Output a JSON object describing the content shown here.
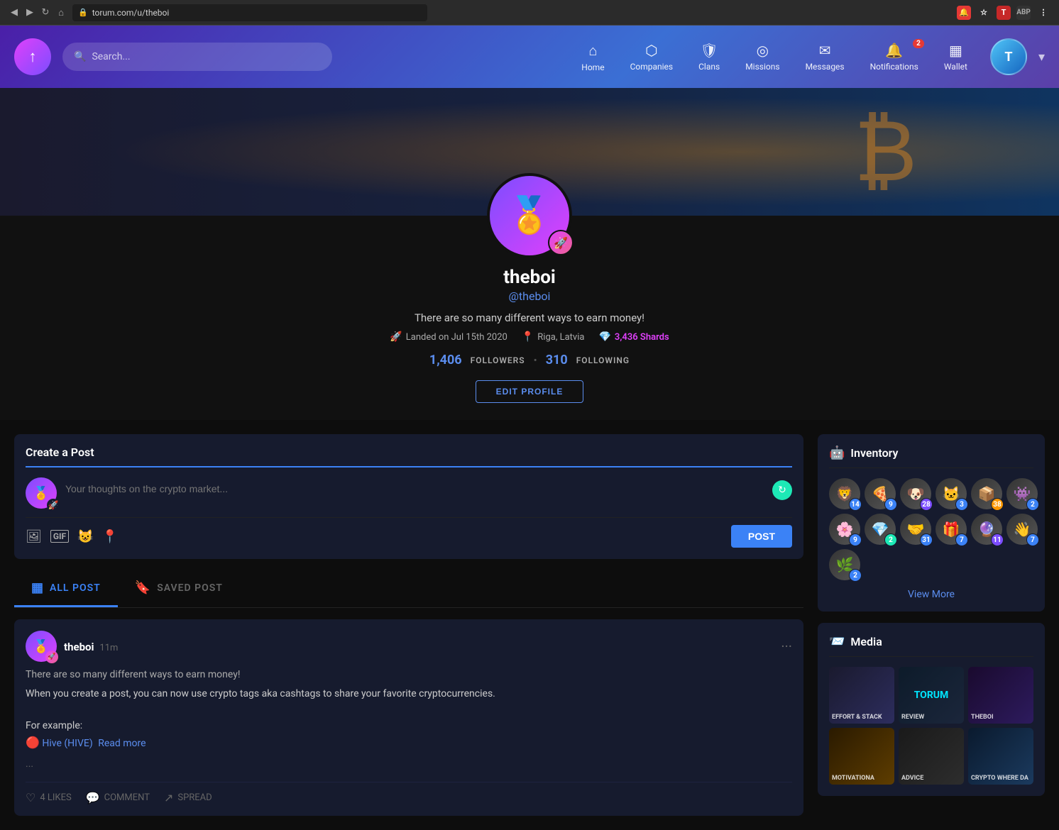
{
  "browser": {
    "url": "torum.com/u/theboi",
    "back_icon": "◀",
    "forward_icon": "▶",
    "reload_icon": "↻",
    "lock_icon": "🔒"
  },
  "nav": {
    "logo_icon": "↑",
    "search_placeholder": "Search...",
    "search_icon": "🔍",
    "items": [
      {
        "label": "Home",
        "icon": "⌂",
        "badge": null
      },
      {
        "label": "Companies",
        "icon": "⬡",
        "badge": null
      },
      {
        "label": "Clans",
        "icon": "🛡",
        "badge": null
      },
      {
        "label": "Missions",
        "icon": "◎",
        "badge": null
      },
      {
        "label": "Messages",
        "icon": "✉",
        "badge": null
      },
      {
        "label": "Notifications",
        "icon": "🔔",
        "badge": "2"
      },
      {
        "label": "Wallet",
        "icon": "▦",
        "badge": null
      }
    ]
  },
  "profile": {
    "username": "theboi",
    "handle": "@theboi",
    "bio": "There are so many different ways to earn money!",
    "joined": "Landed on Jul 15th 2020",
    "location": "Riga, Latvia",
    "shards": "3,436 Shards",
    "followers_count": "1,406",
    "followers_label": "FOLLOWERS",
    "following_count": "310",
    "following_label": "FOLLOWING",
    "edit_btn": "EDIT PROFILE"
  },
  "create_post": {
    "title": "Create a Post",
    "placeholder": "Your thoughts on the crypto market...",
    "post_btn": "POST",
    "icons": [
      "🖼",
      "GIF",
      "😺",
      "📍"
    ]
  },
  "tabs": [
    {
      "label": "ALL POST",
      "active": true
    },
    {
      "label": "SAVED POST",
      "active": false
    }
  ],
  "post": {
    "author": "theboi",
    "time": "11m",
    "subtitle": "There are so many different ways to earn money!",
    "body1": "When you create a post, you can now use crypto tags aka cashtags to share your favorite cryptocurrencies.",
    "body2": "For example:",
    "tag": "Hive (HIVE)",
    "read_more": "Read more",
    "ellipsis": "...",
    "likes": "4 LIKES",
    "comment": "COMMENT",
    "spread": "SPREAD",
    "menu": "···"
  },
  "inventory": {
    "title": "Inventory",
    "icon": "🤖",
    "view_more": "View More",
    "items": [
      {
        "emoji": "🦁",
        "badge": "14",
        "badge_type": ""
      },
      {
        "emoji": "🍕",
        "badge": "9",
        "badge_type": ""
      },
      {
        "emoji": "🐶",
        "badge": "28",
        "badge_type": "purple"
      },
      {
        "emoji": "🐱",
        "badge": "3",
        "badge_type": ""
      },
      {
        "emoji": "📦",
        "badge": "38",
        "badge_type": "orange"
      },
      {
        "emoji": "👾",
        "badge": "2",
        "badge_type": ""
      },
      {
        "emoji": "🌸",
        "badge": "9",
        "badge_type": ""
      },
      {
        "emoji": "💎",
        "badge": "2",
        "badge_type": "green"
      },
      {
        "emoji": "🤝",
        "badge": "31",
        "badge_type": ""
      },
      {
        "emoji": "🎁",
        "badge": "7",
        "badge_type": ""
      },
      {
        "emoji": "🔮",
        "badge": "11",
        "badge_type": "purple"
      },
      {
        "emoji": "👋",
        "badge": "7",
        "badge_type": ""
      },
      {
        "emoji": "🌿",
        "badge": "2",
        "badge_type": ""
      }
    ]
  },
  "media": {
    "title": "Media",
    "icon": "📨",
    "items": [
      {
        "label": "EFFORT & STACK",
        "class": "media-thumb-1"
      },
      {
        "label": "TORUM REVIEW",
        "class": "media-thumb-2"
      },
      {
        "label": "theboi",
        "class": "media-thumb-3"
      },
      {
        "label": "MOTIVATIONA",
        "class": "media-thumb-4"
      },
      {
        "label": "advice",
        "class": "media-thumb-5"
      },
      {
        "label": "CRYPTO WHERE DA",
        "class": "media-thumb-6"
      }
    ]
  }
}
